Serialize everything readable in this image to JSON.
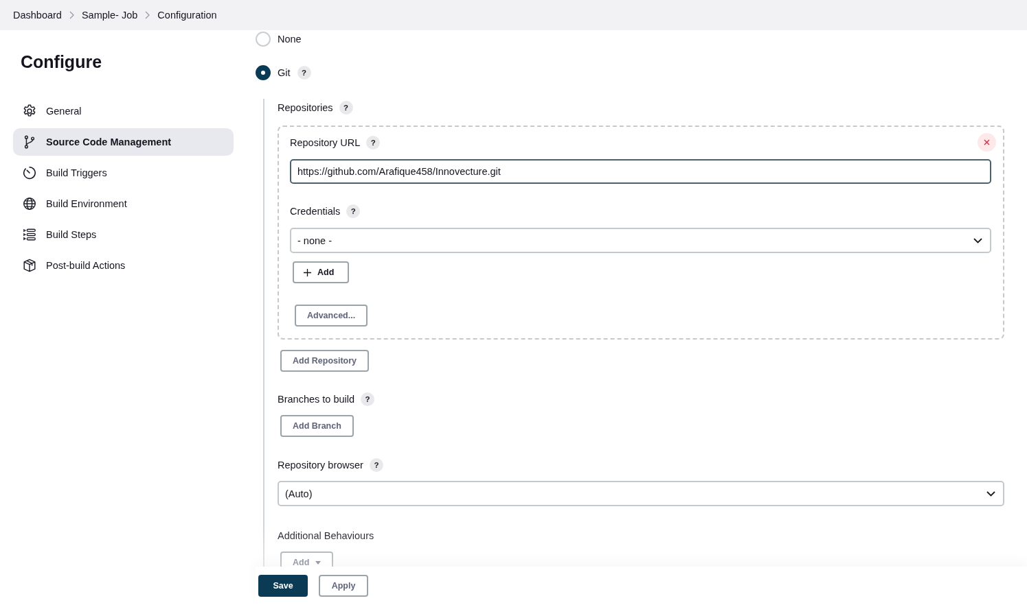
{
  "breadcrumb": [
    {
      "label": "Dashboard"
    },
    {
      "label": "Sample- Job"
    },
    {
      "label": "Configuration"
    }
  ],
  "page_title": "Configure",
  "sidebar": {
    "items": [
      {
        "label": "General",
        "kind": "gear",
        "selected": false
      },
      {
        "label": "Source Code Management",
        "kind": "branch",
        "selected": true
      },
      {
        "label": "Build Triggers",
        "kind": "clock",
        "selected": false
      },
      {
        "label": "Build Environment",
        "kind": "globe",
        "selected": false
      },
      {
        "label": "Build Steps",
        "kind": "list",
        "selected": false
      },
      {
        "label": "Post-build Actions",
        "kind": "box",
        "selected": false
      }
    ]
  },
  "scm_options": [
    {
      "label": "None",
      "selected": false
    },
    {
      "label": "Git",
      "selected": true,
      "help": "?"
    }
  ],
  "repositories": {
    "label": "Repositories",
    "help": "?",
    "repository": {
      "url_label": "Repository URL",
      "url_help": "?",
      "url": "https://github.com/Arafique458/Innovecture.git",
      "credentials_label": "Credentials",
      "credentials_help": "?",
      "credentials": "- none -",
      "add_button": "Add",
      "advanced_button": "Advanced..."
    },
    "add_repository_button": "Add Repository"
  },
  "branches": {
    "label": "Branches to build",
    "help": "?",
    "add_branch_button": "Add Branch"
  },
  "repository_browser": {
    "label": "Repository browser",
    "help": "?",
    "value": "(Auto)"
  },
  "additional_behaviours": {
    "label": "Additional Behaviours",
    "add_button": "Add"
  },
  "footer": {
    "buttons": [
      {
        "label": "Save",
        "kind": "primary"
      },
      {
        "label": "Apply",
        "kind": "secondary"
      }
    ]
  }
}
